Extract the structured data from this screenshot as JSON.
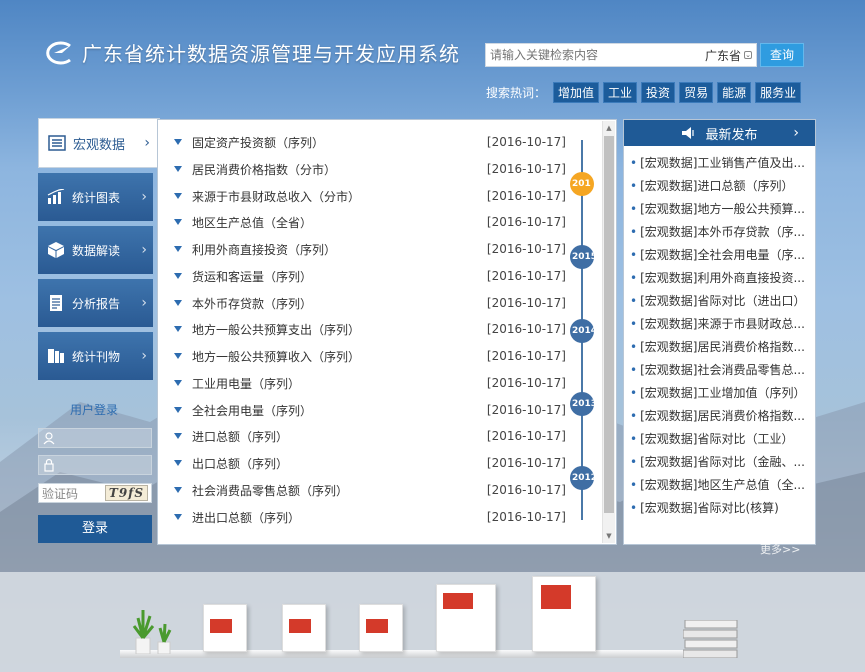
{
  "header": {
    "title": "广东省统计数据资源管理与开发应用系统",
    "search_placeholder": "请输入关键检索内容",
    "region": "广东省",
    "query_button": "查询",
    "hot_label": "搜索热词：",
    "hot_keywords": [
      "增加值",
      "工业",
      "投资",
      "贸易",
      "能源",
      "服务业"
    ]
  },
  "sidebar": {
    "items": [
      {
        "label": "宏观数据",
        "icon": "list-icon"
      },
      {
        "label": "统计图表",
        "icon": "chart-icon"
      },
      {
        "label": "数据解读",
        "icon": "cube-icon"
      },
      {
        "label": "分析报告",
        "icon": "document-icon"
      },
      {
        "label": "统计刊物",
        "icon": "books-icon"
      }
    ]
  },
  "login": {
    "title": "用户登录",
    "captcha_placeholder": "验证码",
    "captcha_code": "T9fS",
    "button": "登录"
  },
  "data_list": {
    "items": [
      {
        "title": "固定资产投资额（序列）",
        "date": "[2016-10-17]"
      },
      {
        "title": "居民消费价格指数（分市）",
        "date": "[2016-10-17]"
      },
      {
        "title": "来源于市县财政总收入（分市）",
        "date": "[2016-10-17]"
      },
      {
        "title": "地区生产总值（全省）",
        "date": "[2016-10-17]"
      },
      {
        "title": "利用外商直接投资（序列）",
        "date": "[2016-10-17]"
      },
      {
        "title": "货运和客运量（序列）",
        "date": "[2016-10-17]"
      },
      {
        "title": "本外币存贷款（序列）",
        "date": "[2016-10-17]"
      },
      {
        "title": "地方一般公共预算支出（序列）",
        "date": "[2016-10-17]"
      },
      {
        "title": "地方一般公共预算收入（序列）",
        "date": "[2016-10-17]"
      },
      {
        "title": "工业用电量（序列）",
        "date": "[2016-10-17]"
      },
      {
        "title": "全社会用电量（序列）",
        "date": "[2016-10-17]"
      },
      {
        "title": "进口总额（序列）",
        "date": "[2016-10-17]"
      },
      {
        "title": "出口总额（序列）",
        "date": "[2016-10-17]"
      },
      {
        "title": "社会消费品零售总额（序列）",
        "date": "[2016-10-17]"
      },
      {
        "title": "进出口总额（序列）",
        "date": "[2016-10-17]"
      }
    ],
    "timeline_years": [
      "201",
      "2015",
      "2014",
      "2013",
      "2012"
    ]
  },
  "news": {
    "title": "最新发布",
    "items": [
      "[宏观数据]工业销售产值及出...",
      "[宏观数据]进口总额（序列）",
      "[宏观数据]地方一般公共预算...",
      "[宏观数据]本外币存贷款（序...",
      "[宏观数据]全社会用电量（序...",
      "[宏观数据]利用外商直接投资...",
      "[宏观数据]省际对比（进出口）",
      "[宏观数据]来源于市县财政总...",
      "[宏观数据]居民消费价格指数...",
      "[宏观数据]社会消费品零售总...",
      "[宏观数据]工业增加值（序列）",
      "[宏观数据]居民消费价格指数...",
      "[宏观数据]省际对比（工业）",
      "[宏观数据]省际对比（金融、...",
      "[宏观数据]地区生产总值（全...",
      "[宏观数据]省际对比(核算)"
    ],
    "more": "更多>>"
  },
  "colors": {
    "brand": "#1f5a96",
    "accent": "#2f9ce0",
    "highlight": "#f5a623"
  }
}
